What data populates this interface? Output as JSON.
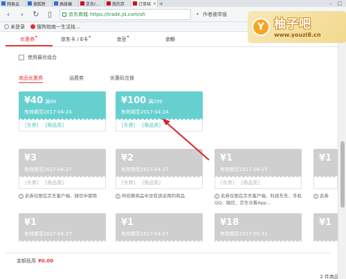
{
  "browser": {
    "tabs": [
      {
        "label": "网易云"
      },
      {
        "label": "搜狐新"
      },
      {
        "label": "高级编"
      },
      {
        "label": "京东(..."
      },
      {
        "label": "我的京"
      },
      {
        "label": "订单结"
      }
    ],
    "new_tab": "+",
    "url_site": "京东商城",
    "url": "https://trade.jd.com/sh",
    "right_label": "作者被举报",
    "bookmarks": [
      "未登录",
      "搜狗指南一生活技..."
    ]
  },
  "watermark": {
    "logo": "Y",
    "title": "柚子吧",
    "url": "www.youzi8.cn"
  },
  "page": {
    "main_tabs": [
      {
        "label": "优惠券",
        "dot": "•"
      },
      {
        "label": "京东卡 / E卡",
        "dot": "•"
      },
      {
        "label": "京豆",
        "dot": "•"
      },
      {
        "label": "余额",
        "dot": ""
      }
    ],
    "best_combo_label": "使用最优组合",
    "sub_tabs": [
      "商品优惠券",
      "运费券",
      "优惠码兑换"
    ],
    "coupons": [
      {
        "amount": "¥40",
        "cond": "满99",
        "validity": "有效期至2017-04-24",
        "tag1": "[东券]",
        "tag2": "[限品类]"
      },
      {
        "amount": "¥100",
        "cond": "满299",
        "validity": "有效期至2017-04-24",
        "tag1": "[东券]",
        "tag2": "[限品类]"
      },
      {
        "amount": "¥3",
        "cond": "",
        "validity": "有效期至2017-04-27",
        "tag1": "[东券]",
        "tag2": "[限品类]"
      },
      {
        "amount": "¥2",
        "cond": "",
        "validity": "有效期至2017-04-27",
        "tag1": "[东券]",
        "tag2": "[限品类]"
      },
      {
        "amount": "¥1",
        "cond": "",
        "validity": "有效期至2017-04-27",
        "tag1": "[东券]",
        "tag2": "[限品类]"
      },
      {
        "amount": "¥1",
        "cond": "",
        "validity": "",
        "tag1": "",
        "tag2": ""
      },
      {
        "amount": "¥1",
        "cond": "",
        "validity": "有效期至2017-04-27",
        "tag1": "",
        "tag2": ""
      },
      {
        "amount": "¥1",
        "cond": "",
        "validity": "有效期至2017-04-27",
        "tag1": "",
        "tag2": ""
      },
      {
        "amount": "¥18",
        "cond": "",
        "validity": "有效期至2017-05-31",
        "tag1": "",
        "tag2": ""
      },
      {
        "amount": "¥1",
        "cond": "",
        "validity": "",
        "tag1": "",
        "tag2": ""
      }
    ],
    "notes": [
      "此券仅限在京东客户端、微信中使用",
      "所结算商品中没有该适用的商品",
      "此券仅限在京东客户端、科技东东、手机QQ、微信、京东众筹App...",
      "此券"
    ],
    "total_label": "金额抵用",
    "total_value": "¥0.00",
    "item_count": "2 件商品"
  },
  "colors": {
    "accent": "#e4393c",
    "coupon_active": "#66d0cf",
    "coupon_disabled": "#cfcfcf",
    "arrow": "#d6262d"
  }
}
